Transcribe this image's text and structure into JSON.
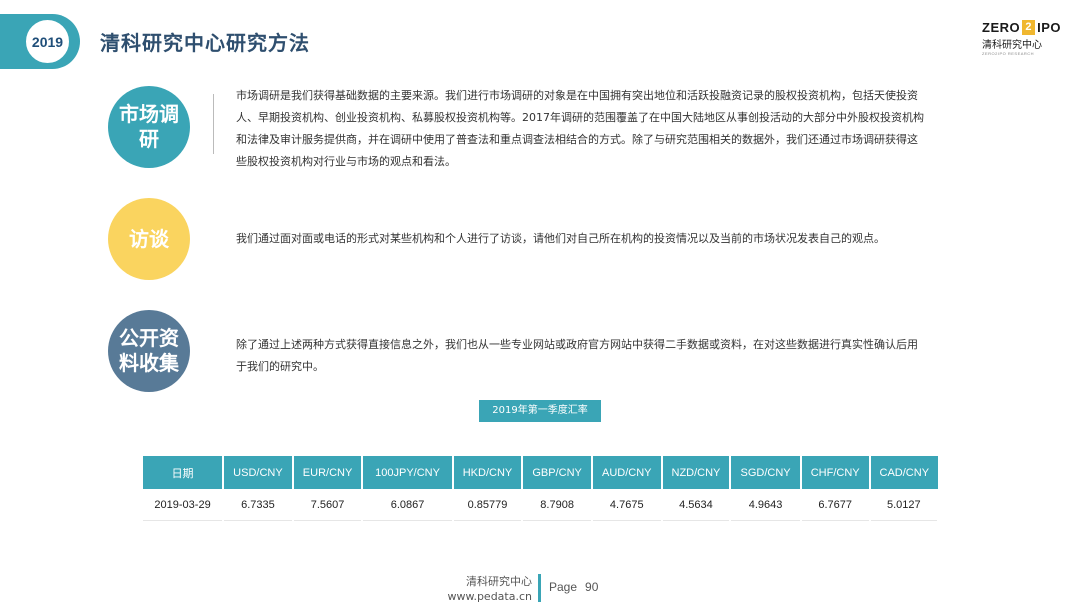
{
  "header": {
    "year": "2019",
    "title": "清科研究中心研究方法",
    "logo": {
      "top": "ZERO",
      "box": "2",
      "tail": "IPO",
      "cn": "清科研究中心",
      "en": "ZERO2IPO RESEARCH"
    }
  },
  "sections": [
    {
      "label": "市场调研",
      "color": "#3aa5b6",
      "text": "市场调研是我们获得基础数据的主要来源。我们进行市场调研的对象是在中国拥有突出地位和活跃投融资记录的股权投资机构，包括天使投资人、早期投资机构、创业投资机构、私募股权投资机构等。2017年调研的范围覆盖了在中国大陆地区从事创投活动的大部分中外股权投资机构和法律及审计服务提供商，并在调研中使用了普查法和重点调查法相结合的方式。除了与研究范围相关的数据外，我们还通过市场调研获得这些股权投资机构对行业与市场的观点和看法。"
    },
    {
      "label": "访谈",
      "color": "#fad45f",
      "text": "我们通过面对面或电话的形式对某些机构和个人进行了访谈，请他们对自己所在机构的投资情况以及当前的市场状况发表自己的观点。"
    },
    {
      "label": "公开资料收集",
      "color": "#587a97",
      "text": "除了通过上述两种方式获得直接信息之外，我们也从一些专业网站或政府官方网站中获得二手数据或资料，在对这些数据进行真实性确认后用于我们的研究中。"
    }
  ],
  "rate_table": {
    "title": "2019年第一季度汇率",
    "headers": [
      "日期",
      "USD/CNY",
      "EUR/CNY",
      "100JPY/CNY",
      "HKD/CNY",
      "GBP/CNY",
      "AUD/CNY",
      "NZD/CNY",
      "SGD/CNY",
      "CHF/CNY",
      "CAD/CNY"
    ],
    "rows": [
      [
        "2019-03-29",
        "6.7335",
        "7.5607",
        "6.0867",
        "0.85779",
        "8.7908",
        "4.7675",
        "4.5634",
        "4.9643",
        "6.7677",
        "5.0127"
      ]
    ]
  },
  "footer": {
    "org": "清科研究中心",
    "url": "www.pedata.cn",
    "page_label": "Page",
    "page_number": "90"
  }
}
